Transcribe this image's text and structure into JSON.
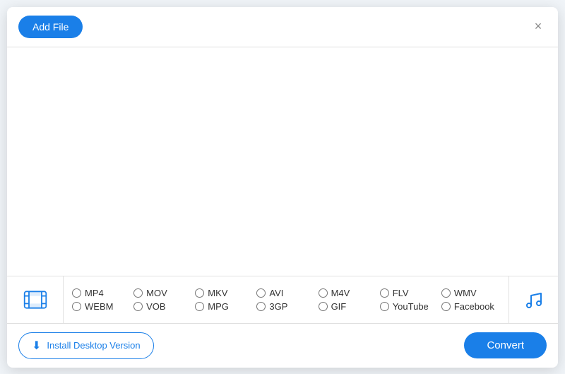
{
  "header": {
    "add_file_label": "Add File",
    "close_label": "×"
  },
  "formats": {
    "video_formats_row1": [
      {
        "id": "mp4",
        "label": "MP4"
      },
      {
        "id": "mov",
        "label": "MOV"
      },
      {
        "id": "mkv",
        "label": "MKV"
      },
      {
        "id": "avi",
        "label": "AVI"
      },
      {
        "id": "m4v",
        "label": "M4V"
      },
      {
        "id": "flv",
        "label": "FLV"
      },
      {
        "id": "wmv",
        "label": "WMV"
      }
    ],
    "video_formats_row2": [
      {
        "id": "webm",
        "label": "WEBM"
      },
      {
        "id": "vob",
        "label": "VOB"
      },
      {
        "id": "mpg",
        "label": "MPG"
      },
      {
        "id": "3gp",
        "label": "3GP"
      },
      {
        "id": "gif",
        "label": "GIF"
      },
      {
        "id": "youtube",
        "label": "YouTube"
      },
      {
        "id": "facebook",
        "label": "Facebook"
      }
    ]
  },
  "footer": {
    "install_label": "Install Desktop Version",
    "convert_label": "Convert"
  },
  "colors": {
    "accent": "#1a7fe8",
    "border": "#e0e0e0",
    "text": "#333333"
  }
}
